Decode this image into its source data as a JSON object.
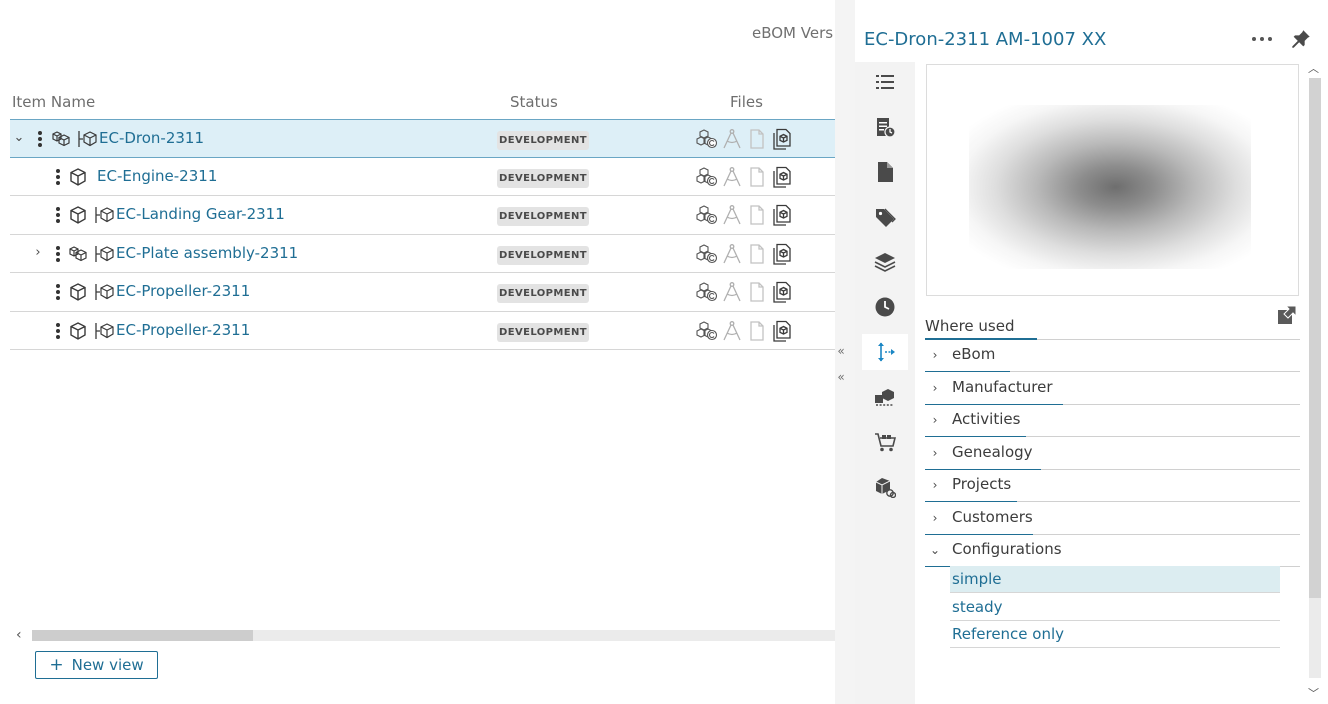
{
  "header": {
    "version_label": "eBOM Vers"
  },
  "columns": {
    "item_name": "Item Name",
    "status": "Status",
    "files": "Files"
  },
  "rows": [
    {
      "name": "EC-Dron-2311",
      "status": "DEVELOPMENT",
      "expand": "expanded",
      "icon": "assembly-icon",
      "selected": true
    },
    {
      "name": "EC-Engine-2311",
      "status": "DEVELOPMENT",
      "expand": "none",
      "icon": "part-icon",
      "selected": false
    },
    {
      "name": "EC-Landing Gear-2311",
      "status": "DEVELOPMENT",
      "expand": "none",
      "icon": "part-icon",
      "selected": false
    },
    {
      "name": "EC-Plate assembly-2311",
      "status": "DEVELOPMENT",
      "expand": "collapsed",
      "icon": "assembly-icon",
      "selected": false
    },
    {
      "name": "EC-Propeller-2311",
      "status": "DEVELOPMENT",
      "expand": "none",
      "icon": "part-icon",
      "selected": false
    },
    {
      "name": "EC-Propeller-2311",
      "status": "DEVELOPMENT",
      "expand": "none",
      "icon": "part-icon",
      "selected": false
    }
  ],
  "new_view_label": "New view",
  "panel": {
    "title": "EC-Dron-2311 AM-1007 XX",
    "toolbar_icons": [
      "list-icon",
      "history-document-icon",
      "document-icon",
      "tag-icon",
      "layers-icon",
      "clock-icon",
      "where-used-icon",
      "change-icon",
      "cart-icon",
      "configuration-icon"
    ],
    "active_tool": "where-used-icon",
    "where_used_title": "Where used",
    "sections": [
      {
        "label": "eBom",
        "expanded": false
      },
      {
        "label": "Manufacturer",
        "expanded": false
      },
      {
        "label": "Activities",
        "expanded": false
      },
      {
        "label": "Genealogy",
        "expanded": false
      },
      {
        "label": "Projects",
        "expanded": false
      },
      {
        "label": "Customers",
        "expanded": false
      },
      {
        "label": "Configurations",
        "expanded": true
      }
    ],
    "configurations": [
      {
        "label": "simple",
        "selected": true
      },
      {
        "label": "steady",
        "selected": false
      },
      {
        "label": "Reference only",
        "selected": false
      }
    ]
  },
  "colors": {
    "accent": "#1f6e94",
    "selected_row": "#ddeff7",
    "badge_bg": "#e3e3e3"
  }
}
